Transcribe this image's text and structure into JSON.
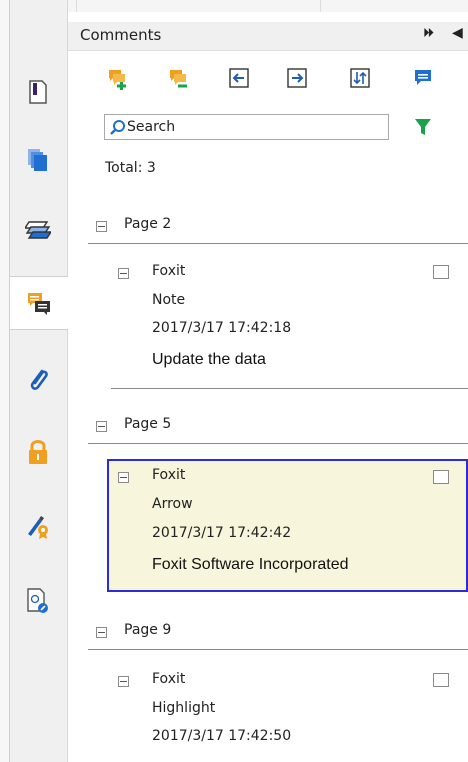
{
  "panel": {
    "title": "Comments",
    "pin_glyph": "⏵⏵",
    "collapse_glyph": "◀"
  },
  "toolbar": {
    "buttons": [
      {
        "name": "expand-all-icon"
      },
      {
        "name": "collapse-all-icon"
      },
      {
        "name": "previous-comment-icon"
      },
      {
        "name": "next-comment-icon"
      },
      {
        "name": "sort-icon"
      },
      {
        "name": "comment-icon"
      }
    ]
  },
  "search": {
    "placeholder": "Search"
  },
  "total_label": "Total: 3",
  "groups": [
    {
      "page_label": "Page 2",
      "comment": {
        "author": "Foxit",
        "type": "Note",
        "timestamp": "2017/3/17 17:42:18",
        "text": "Update the data"
      }
    },
    {
      "page_label": "Page 5",
      "comment": {
        "author": "Foxit",
        "type": "Arrow",
        "timestamp": "2017/3/17 17:42:42",
        "text": "Foxit Software Incorporated"
      }
    },
    {
      "page_label": "Page 9",
      "comment": {
        "author": "Foxit",
        "type": "Highlight",
        "timestamp": "2017/3/17 17:42:50",
        "text": ""
      }
    }
  ],
  "rail": [
    {
      "name": "page-thumbnail-icon"
    },
    {
      "name": "copy-pages-icon"
    },
    {
      "name": "layers-icon"
    },
    {
      "name": "comments-panel-icon"
    },
    {
      "name": "attachments-icon"
    },
    {
      "name": "security-lock-icon"
    },
    {
      "name": "digital-signature-icon"
    },
    {
      "name": "certificate-icon"
    }
  ],
  "colors": {
    "accent_orange": "#f0a020",
    "accent_blue": "#1e6fd0",
    "accent_green": "#17a34a",
    "selection_border": "#2b2bd9",
    "selection_fill": "#f7f5db"
  }
}
